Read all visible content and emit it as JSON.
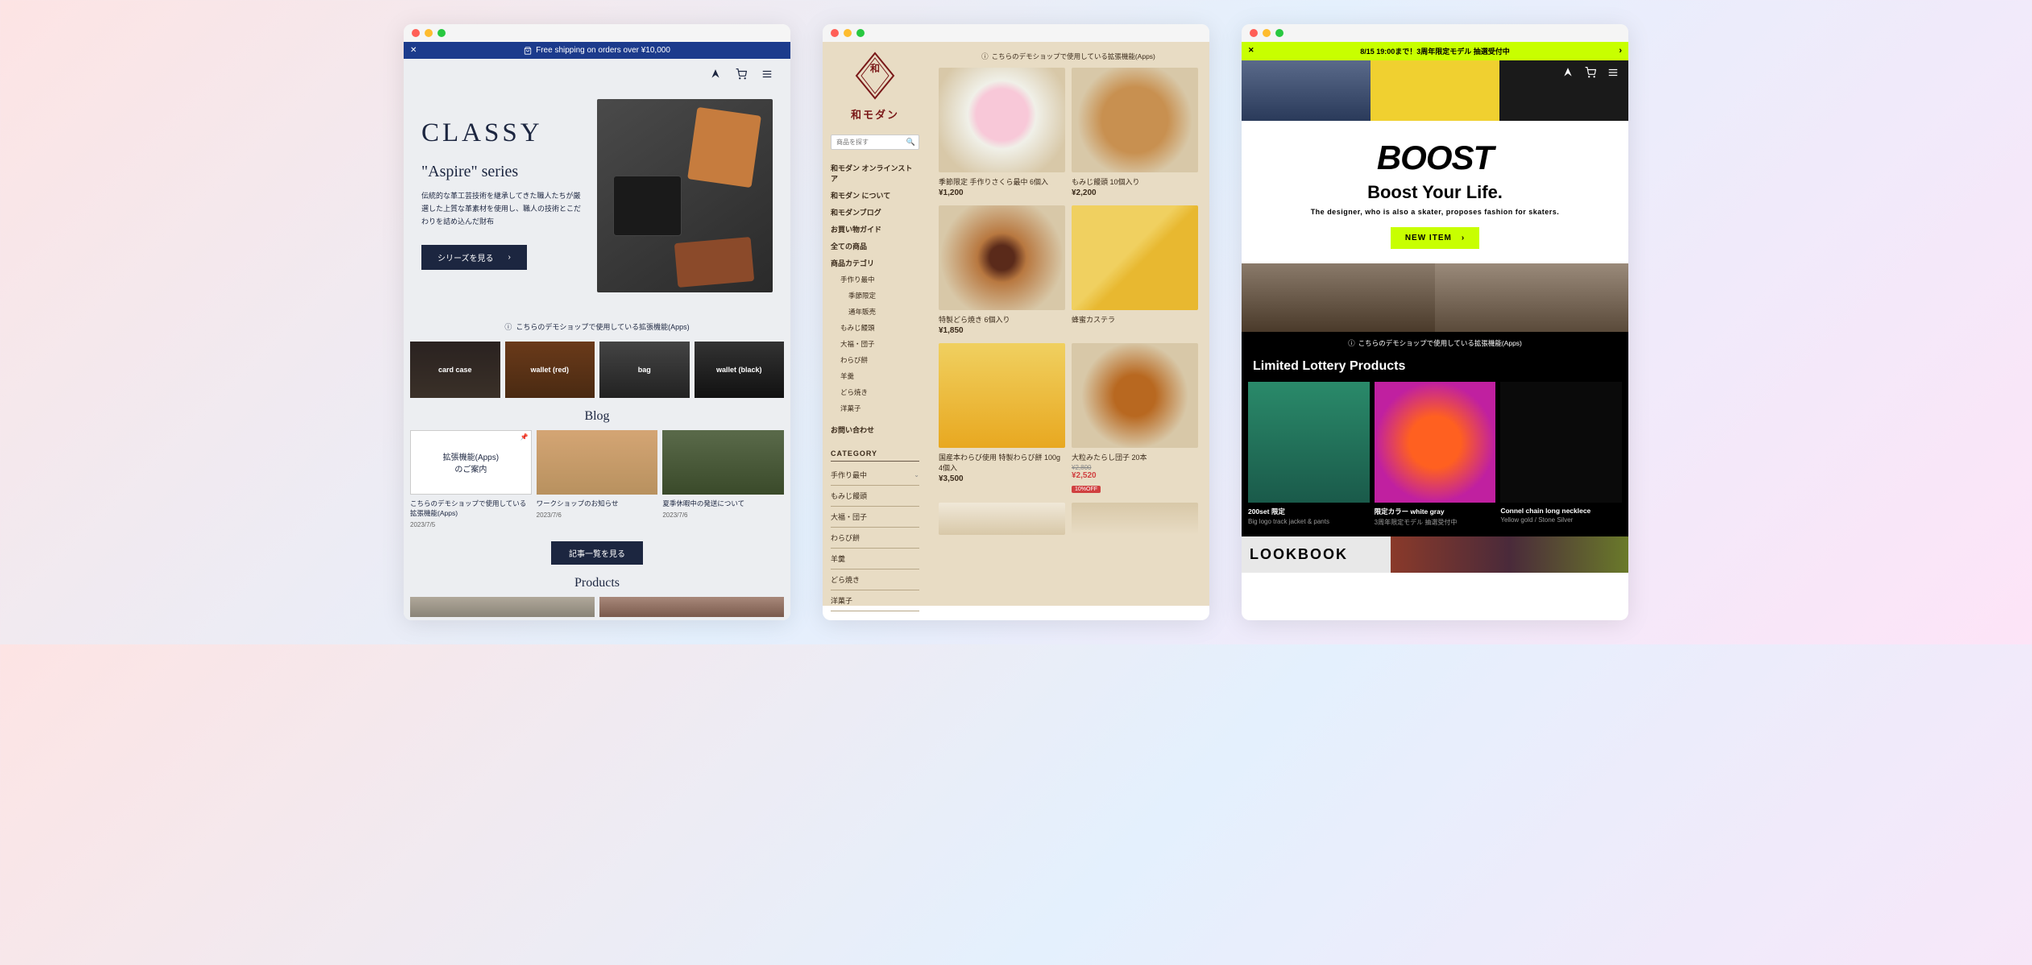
{
  "classy": {
    "banner": "Free shipping on orders over ¥10,000",
    "hero_title": "CLASSY",
    "hero_subtitle": "\"Aspire\" series",
    "hero_desc": "伝統的な革工芸技術を継承してきた職人たちが厳選した上質な革素材を使用し、職人の技術とこだわりを詰め込んだ財布",
    "cta": "シリーズを見る",
    "apps_note": "こちらのデモショップで使用している拡張機能(Apps)",
    "categories": [
      "card case",
      "wallet (red)",
      "bag",
      "wallet (black)"
    ],
    "blog_heading": "Blog",
    "blog": [
      {
        "title_line1": "拡張機能(Apps)",
        "title_line2": "のご案内",
        "caption": "こちらのデモショップで使用している拡張機能(Apps)",
        "date": "2023/7/5"
      },
      {
        "caption": "ワークショップのお知らせ",
        "date": "2023/7/6"
      },
      {
        "caption": "夏季休暇中の発送について",
        "date": "2023/7/6"
      }
    ],
    "blog_btn": "記事一覧を見る",
    "products_heading": "Products"
  },
  "modern": {
    "logo": "和モダン",
    "search_placeholder": "商品を探す",
    "menu": [
      "和モダン オンラインストア",
      "和モダン について",
      "和モダンブログ",
      "お買い物ガイド",
      "全ての商品",
      "商品カテゴリ"
    ],
    "submenu": [
      "手作り最中",
      "季節限定",
      "通年販売",
      "もみじ饅頭",
      "大福・団子",
      "わらび餅",
      "羊羹",
      "どら焼き",
      "洋菓子"
    ],
    "contact": "お問い合わせ",
    "category_heading": "CATEGORY",
    "categories": [
      "手作り最中",
      "もみじ饅頭",
      "大福・団子",
      "わらび餅",
      "羊羹",
      "どら焼き",
      "洋菓子"
    ],
    "apps_note": "こちらのデモショップで使用している拡張機能(Apps)",
    "products": [
      {
        "name": "季節限定 手作りさくら最中 6個入",
        "price": "¥1,200"
      },
      {
        "name": "もみじ饅頭 10個入り",
        "price": "¥2,200"
      },
      {
        "name": "特製どら焼き 6個入り",
        "price": "¥1,850"
      },
      {
        "name": "蜂蜜カステラ",
        "price": ""
      },
      {
        "name": "国産本わらび使用 特製わらび餅 100g 4個入",
        "price": "¥3,500"
      },
      {
        "name": "大粒みたらし団子 20本",
        "old_price": "¥2,800",
        "price": "¥2,520",
        "tag": "10%OFF",
        "sale": true
      }
    ]
  },
  "boost": {
    "banner": "8/15 19:00まで！3周年限定モデル 抽選受付中",
    "brand_title": "BOOST",
    "brand_subtitle": "Boost Your Life.",
    "brand_desc": "The designer, who is also a skater, proposes fashion for skaters.",
    "cta": "NEW ITEM",
    "apps_note": "こちらのデモショップで使用している拡張機能(Apps)",
    "section_heading": "Limited Lottery Products",
    "products": [
      {
        "name": "200set 限定",
        "desc": "Big logo track jacket & pants"
      },
      {
        "name": "限定カラー white gray",
        "desc": "3周年限定モデル 抽選受付中"
      },
      {
        "name": "Connel chain long necklece",
        "desc": "Yellow gold / Stone Silver"
      }
    ],
    "lookbook": "LOOKBOOK"
  }
}
